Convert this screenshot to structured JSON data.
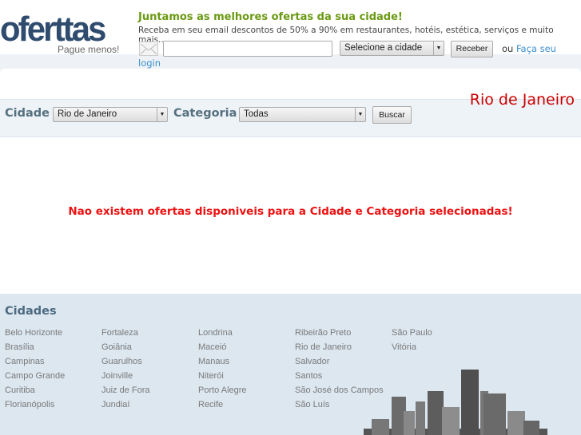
{
  "logo": {
    "name": "oferttas",
    "slogan": "Pague menos!"
  },
  "header": {
    "tagline": "Juntamos as melhores ofertas da sua cidade!",
    "subtitle": "Receba em seu email descontos de 50% a 90% em restaurantes, hotéis, estética, serviços e muito mais...",
    "email_value": "",
    "city_select": "Selecione a cidade",
    "receive_button": "Receber",
    "or_text": "ou",
    "login_link_1": "Faça seu",
    "login_link_2": "login"
  },
  "filter": {
    "city_label": "Cidade",
    "city_value": "Rio de Janeiro",
    "category_label": "Categoria",
    "category_value": "Todas",
    "search_button": "Buscar",
    "current_city": "Rio de Janeiro"
  },
  "message": "Nao existem ofertas disponiveis para a Cidade e Categoria selecionadas!",
  "footer": {
    "title": "Cidades",
    "columns": [
      [
        "Belo Horizonte",
        "Brasília",
        "Campinas",
        "Campo Grande",
        "Curitiba",
        "Florianópolis"
      ],
      [
        "Fortaleza",
        "Goiânia",
        "Guarulhos",
        "Joinville",
        "Juiz de Fora",
        "Jundiaí"
      ],
      [
        "Londrina",
        "Maceió",
        "Manaus",
        "Niterói",
        "Porto Alegre",
        "Recife"
      ],
      [
        "Ribeirão Preto",
        "Rio de Janeiro",
        "Salvador",
        "Santos",
        "São José dos Campos",
        "São Luís"
      ],
      [
        "São Paulo",
        "Vitória"
      ]
    ]
  }
}
